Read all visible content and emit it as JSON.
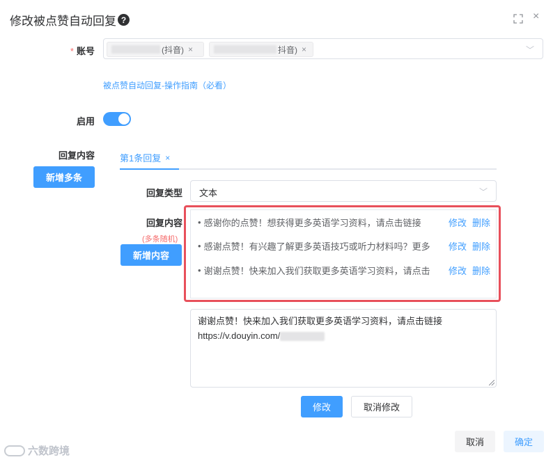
{
  "dialog": {
    "title": "修改被点赞自动回复",
    "help_glyph": "?",
    "fullscreen_glyph": "⛶",
    "close_glyph": "×"
  },
  "account": {
    "label": "账号",
    "required_mark": "*",
    "tags": [
      {
        "suffix": "(抖音)",
        "remove": "×"
      },
      {
        "suffix": "抖音)",
        "remove": "×"
      }
    ],
    "chevron": "﹀"
  },
  "guide_link": "被点赞自动回复-操作指南（必看）",
  "enable": {
    "label": "启用",
    "on": true
  },
  "reply_content": {
    "label": "回复内容",
    "add_more_button": "新增多条"
  },
  "tabs": [
    {
      "label": "第1条回复",
      "close": "×"
    }
  ],
  "reply_type": {
    "label": "回复类型",
    "value": "文本",
    "chevron": "﹀"
  },
  "reply_list": {
    "label": "回复内容",
    "hint": "(多条随机)",
    "add_button": "新增内容",
    "items": [
      {
        "text": "感谢你的点赞！想获得更多英语学习资料，请点击链接",
        "edit": "修改",
        "delete": "删除"
      },
      {
        "text": "感谢点赞！有兴趣了解更多英语技巧或听力材料吗？更多",
        "edit": "修改",
        "delete": "删除"
      },
      {
        "text": "谢谢点赞！快来加入我们获取更多英语学习资料，请点击",
        "edit": "修改",
        "delete": "删除"
      }
    ],
    "bullet": "•"
  },
  "editor": {
    "line1": "谢谢点赞！快来加入我们获取更多英语学习资料，请点击链接",
    "line2": "https://v.douyin.com/"
  },
  "edit_actions": {
    "save": "修改",
    "cancel": "取消修改"
  },
  "footer": {
    "cancel": "取消",
    "confirm": "确定"
  },
  "watermark": {
    "text": "六数跨境"
  },
  "colors": {
    "primary": "#409eff",
    "danger": "#f56c6c",
    "highlight": "#e8505b"
  }
}
